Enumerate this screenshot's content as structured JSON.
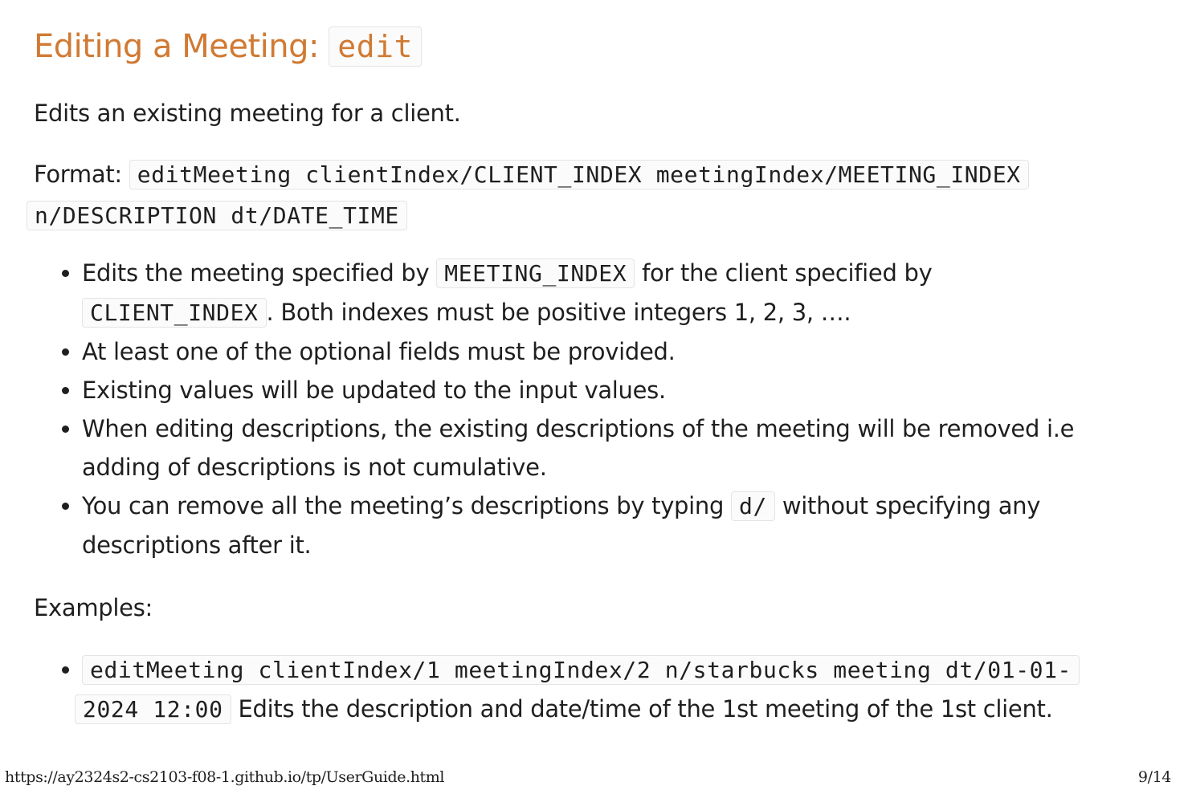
{
  "heading": {
    "text": "Editing a Meeting: ",
    "code": "edit"
  },
  "intro": "Edits an existing meeting for a client.",
  "format": {
    "label": "Format: ",
    "code_line1": "editMeeting clientIndex/CLIENT_INDEX meetingIndex/MEETING_INDEX",
    "code_line2": "n/DESCRIPTION dt/DATE_TIME"
  },
  "bullets": {
    "b1": {
      "t1": "Edits the meeting specified by ",
      "c1": "MEETING_INDEX",
      "t2": " for the client specified by",
      "c2": "CLIENT_INDEX",
      "t3": ". Both indexes must be positive integers 1, 2, 3, …."
    },
    "b2": "At least one of the optional fields must be provided.",
    "b3": "Existing values will be updated to the input values.",
    "b4": "When editing descriptions, the existing descriptions of the meeting will be removed i.e adding of descriptions is not cumulative.",
    "b5": {
      "t1": "You can remove all the meeting’s descriptions by typing ",
      "c1": "d/",
      "t2": " without specifying any descriptions after it."
    }
  },
  "examples": {
    "label": "Examples:",
    "items": [
      {
        "code_line1": "editMeeting clientIndex/1 meetingIndex/2 n/starbucks meeting dt/01-01-",
        "code_line2": "2024 12:00",
        "desc": " Edits the description and date/time of the 1st meeting of the 1st client."
      }
    ]
  },
  "footer": {
    "url": "https://ay2324s2-cs2103-f08-1.github.io/tp/UserGuide.html",
    "page": "9/14"
  }
}
